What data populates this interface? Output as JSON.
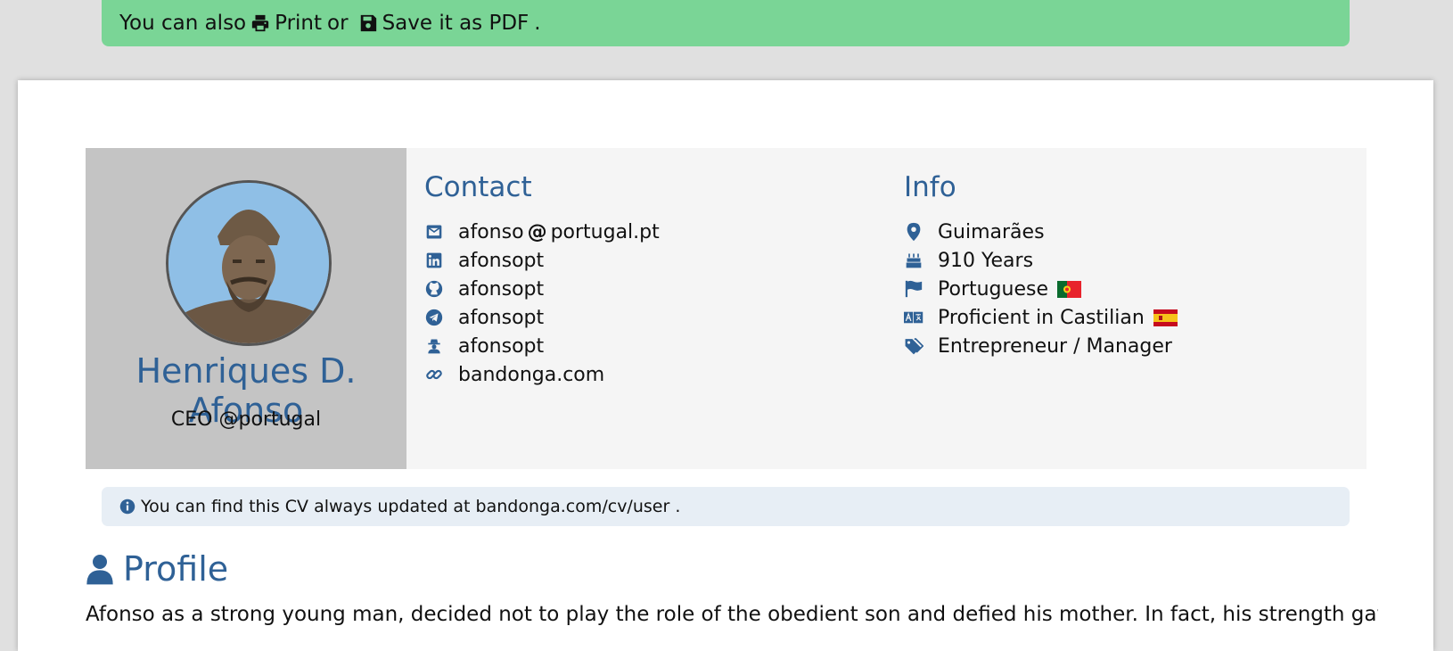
{
  "banner": {
    "prefix": "You can also",
    "print_label": "Print",
    "or": "or",
    "save_label": "Save it as PDF",
    "suffix": "."
  },
  "person": {
    "name": "Henriques D. Afonso",
    "role": "CEO @portugal"
  },
  "contact": {
    "title": "Contact",
    "email_user": "afonso",
    "email_at": "@",
    "email_domain": "portugal.pt",
    "linkedin": "afonsopt",
    "github": "afonsopt",
    "telegram": "afonsopt",
    "other": "afonsopt",
    "website": "bandonga.com"
  },
  "info": {
    "title": "Info",
    "location": "Guimarães",
    "age": "910 Years",
    "nationality": "Portuguese",
    "language": "Proficient in Castilian",
    "occupation": "Entrepreneur / Manager"
  },
  "notice": {
    "text": "You can find this CV always updated at bandonga.com/cv/user ."
  },
  "profile": {
    "title": "Profile",
    "text": "Afonso as a strong young man, decided not to play the role of the obedient son and defied his mother. In fact, his strength gave"
  },
  "colors": {
    "banner_bg": "#7ad596",
    "accent": "#2f6196",
    "notice_bg": "#e7eef5",
    "photo_panel_bg": "#c4c4c4"
  }
}
